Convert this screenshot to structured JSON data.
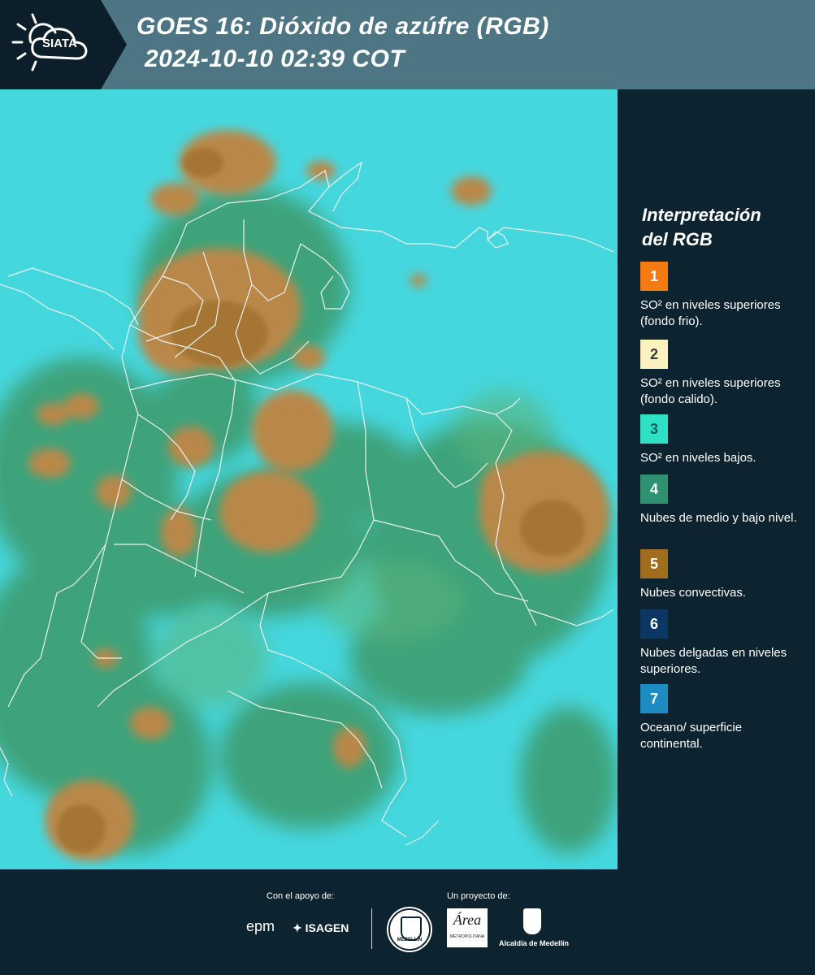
{
  "header": {
    "title_line1": "GOES 16: Dióxido de azúfre (RGB)",
    "title_line2": "2024-10-10 02:39 COT",
    "logo_text": "SIATA"
  },
  "legend": {
    "title": "Interpretación del RGB",
    "items": [
      {
        "number": "1",
        "label": "SO² en niveles superiores (fondo frio).",
        "color": "#f47b12",
        "text_color": "#ffffff"
      },
      {
        "number": "2",
        "label": "SO² en niveles superiores (fondo calido).",
        "color": "#fbf2bf",
        "text_color": "#3a3a3a"
      },
      {
        "number": "3",
        "label": "SO² en niveles bajos.",
        "color": "#2ee0c4",
        "text_color": "#1b5d5a"
      },
      {
        "number": "4",
        "label": "Nubes de medio y bajo nivel.",
        "color": "#2e9270",
        "text_color": "#ffffff"
      },
      {
        "number": "5",
        "label": "Nubes convectivas.",
        "color": "#a06d1d",
        "text_color": "#ffffff"
      },
      {
        "number": "6",
        "label": "Nubes delgadas en niveles superiores.",
        "color": "#0c3764",
        "text_color": "#ffffff"
      },
      {
        "number": "7",
        "label": "Oceano/ superficie continental.",
        "color": "#1c8cc3",
        "text_color": "#ffffff"
      }
    ]
  },
  "footer": {
    "support_label": "Con el apoyo de:",
    "project_label": "Un proyecto de:",
    "sponsors": [
      "epm",
      "ISAGEN"
    ],
    "partners": [
      "Área Metropolitana Valle de Aburrá",
      "Alcaldía de Medellín"
    ],
    "metropolitana_text": "METROPOLITANA",
    "area_text": "Área",
    "alcaldia_text": "Alcaldía de Medellín",
    "medellin_seal_text": "MEDELLÍN"
  }
}
